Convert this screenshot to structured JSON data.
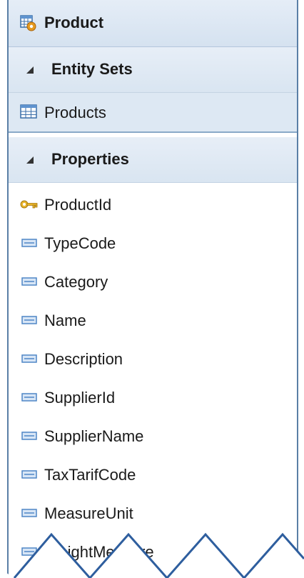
{
  "entity": {
    "title": "Product",
    "title_icon": "entity-table-gear-icon"
  },
  "entity_sets": {
    "header": "Entity Sets",
    "items": [
      {
        "label": "Products",
        "icon": "table-grid-icon"
      }
    ]
  },
  "properties": {
    "header": "Properties",
    "items": [
      {
        "label": "ProductId",
        "icon": "key-icon"
      },
      {
        "label": "TypeCode",
        "icon": "property-icon"
      },
      {
        "label": "Category",
        "icon": "property-icon"
      },
      {
        "label": "Name",
        "icon": "property-icon"
      },
      {
        "label": "Description",
        "icon": "property-icon"
      },
      {
        "label": "SupplierId",
        "icon": "property-icon"
      },
      {
        "label": "SupplierName",
        "icon": "property-icon"
      },
      {
        "label": "TaxTarifCode",
        "icon": "property-icon"
      },
      {
        "label": "MeasureUnit",
        "icon": "property-icon"
      },
      {
        "label": "WeightMeasure",
        "icon": "property-icon"
      }
    ]
  },
  "colors": {
    "border": "#5a7fa6",
    "header_bg": "#dbe6f2",
    "property_icon": "#4f86c6",
    "key_icon": "#d9a520",
    "zigzag_stroke": "#2e5e9e"
  }
}
